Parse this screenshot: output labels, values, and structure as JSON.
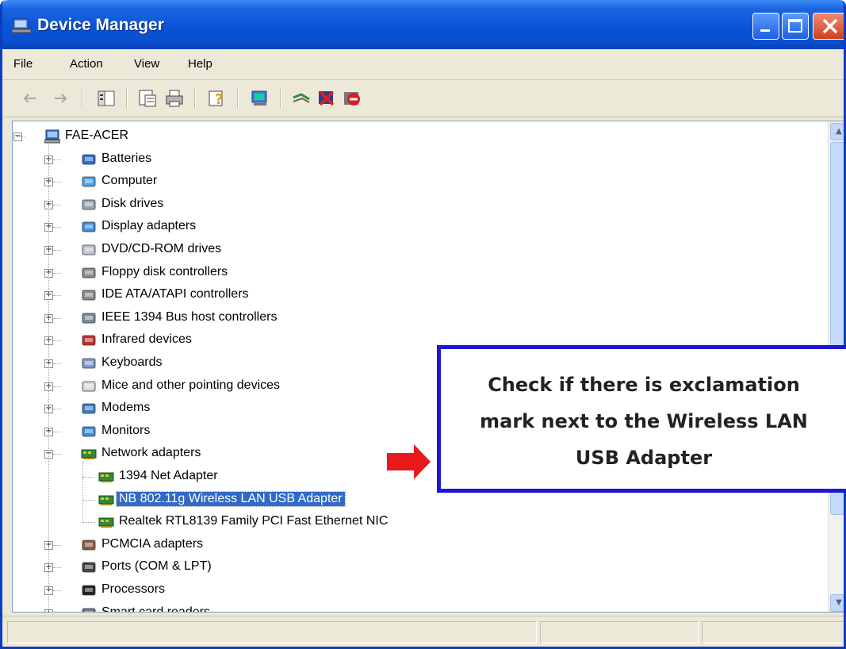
{
  "window": {
    "title": "Device Manager"
  },
  "menu": [
    "File",
    "Action",
    "View",
    "Help"
  ],
  "toolbar_icons": [
    "back-icon",
    "forward-icon",
    "console-tree-icon",
    "properties-icon",
    "print-icon",
    "help-icon",
    "computer-icon",
    "scan-hardware-icon",
    "uninstall-icon",
    "disable-icon"
  ],
  "tree": {
    "root": "FAE-ACER",
    "categories": [
      {
        "label": "Batteries",
        "icon": "battery-icon"
      },
      {
        "label": "Computer",
        "icon": "computer-icon"
      },
      {
        "label": "Disk drives",
        "icon": "disk-drive-icon"
      },
      {
        "label": "Display adapters",
        "icon": "display-adapter-icon"
      },
      {
        "label": "DVD/CD-ROM drives",
        "icon": "dvd-icon"
      },
      {
        "label": "Floppy disk controllers",
        "icon": "floppy-controller-icon"
      },
      {
        "label": "IDE ATA/ATAPI controllers",
        "icon": "ide-controller-icon"
      },
      {
        "label": "IEEE 1394 Bus host controllers",
        "icon": "ieee1394-icon"
      },
      {
        "label": "Infrared devices",
        "icon": "infrared-icon"
      },
      {
        "label": "Keyboards",
        "icon": "keyboard-icon"
      },
      {
        "label": "Mice and other pointing devices",
        "icon": "mouse-icon"
      },
      {
        "label": "Modems",
        "icon": "modem-icon"
      },
      {
        "label": "Monitors",
        "icon": "monitor-icon"
      },
      {
        "label": "Network adapters",
        "icon": "network-adapter-icon",
        "expanded": true
      },
      {
        "label": "PCMCIA adapters",
        "icon": "pcmcia-icon"
      },
      {
        "label": "Ports (COM & LPT)",
        "icon": "port-icon"
      },
      {
        "label": "Processors",
        "icon": "processor-icon"
      },
      {
        "label": "Smart card readers",
        "icon": "smart-card-icon"
      }
    ],
    "network_children": [
      {
        "label": "1394 Net Adapter"
      },
      {
        "label": "NB 802.11g Wireless LAN USB Adapter",
        "selected": true
      },
      {
        "label": "Realtek RTL8139 Family PCI Fast Ethernet NIC"
      }
    ]
  },
  "callout": {
    "lines": [
      "Check if there is exclamation",
      "mark next to the Wireless LAN",
      "USB Adapter"
    ]
  },
  "colors": {
    "titlebar": "#0a54d6",
    "selection": "#316ac5",
    "callout_border": "#1a18d6",
    "arrow": "#e8191b"
  }
}
